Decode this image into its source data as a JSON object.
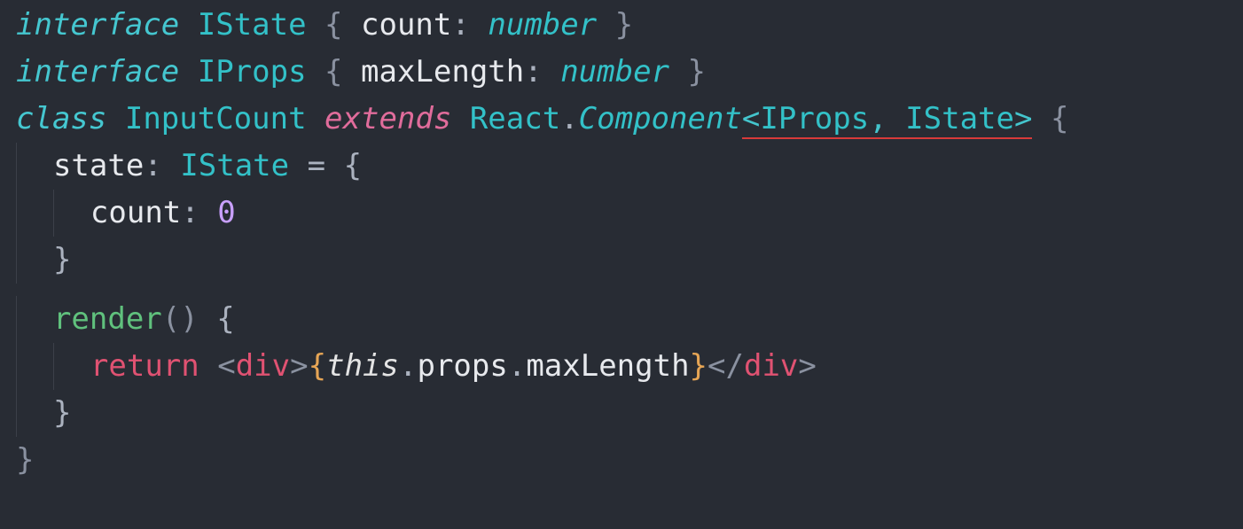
{
  "code": {
    "lines": [
      {
        "tokens": [
          {
            "cls": "kw",
            "t": "interface"
          },
          {
            "cls": "",
            "t": " "
          },
          {
            "cls": "type",
            "t": "IState"
          },
          {
            "cls": "",
            "t": " "
          },
          {
            "cls": "pale",
            "t": "{"
          },
          {
            "cls": "",
            "t": " "
          },
          {
            "cls": "ident",
            "t": "count"
          },
          {
            "cls": "punc",
            "t": ":"
          },
          {
            "cls": "",
            "t": " "
          },
          {
            "cls": "typei",
            "t": "number"
          },
          {
            "cls": "",
            "t": " "
          },
          {
            "cls": "pale",
            "t": "}"
          }
        ]
      },
      {
        "tokens": [
          {
            "cls": "kw",
            "t": "interface"
          },
          {
            "cls": "",
            "t": " "
          },
          {
            "cls": "type",
            "t": "IProps"
          },
          {
            "cls": "",
            "t": " "
          },
          {
            "cls": "pale",
            "t": "{"
          },
          {
            "cls": "",
            "t": " "
          },
          {
            "cls": "ident",
            "t": "maxLength"
          },
          {
            "cls": "punc",
            "t": ":"
          },
          {
            "cls": "",
            "t": " "
          },
          {
            "cls": "typei",
            "t": "number"
          },
          {
            "cls": "",
            "t": " "
          },
          {
            "cls": "pale",
            "t": "}"
          }
        ]
      },
      {
        "tokens": [
          {
            "cls": "kw",
            "t": "class"
          },
          {
            "cls": "",
            "t": " "
          },
          {
            "cls": "type",
            "t": "InputCount"
          },
          {
            "cls": "",
            "t": " "
          },
          {
            "cls": "kw2",
            "t": "extends"
          },
          {
            "cls": "",
            "t": " "
          },
          {
            "cls": "type",
            "t": "React"
          },
          {
            "cls": "punc",
            "t": "."
          },
          {
            "cls": "typei",
            "t": "Component"
          },
          {
            "cls": "genang uline",
            "t": "<"
          },
          {
            "cls": "type uline",
            "t": "IProps"
          },
          {
            "cls": "genang uline",
            "t": ","
          },
          {
            "cls": "uline",
            "t": " "
          },
          {
            "cls": "type uline",
            "t": "IState"
          },
          {
            "cls": "genang uline",
            "t": ">"
          },
          {
            "cls": "",
            "t": " "
          },
          {
            "cls": "pale",
            "t": "{"
          }
        ]
      },
      {
        "indent": 1,
        "tokens": [
          {
            "cls": "ident",
            "t": "state"
          },
          {
            "cls": "punc",
            "t": ":"
          },
          {
            "cls": "",
            "t": " "
          },
          {
            "cls": "type",
            "t": "IState"
          },
          {
            "cls": "",
            "t": " "
          },
          {
            "cls": "punc",
            "t": "="
          },
          {
            "cls": "",
            "t": " "
          },
          {
            "cls": "punc",
            "t": "{"
          }
        ]
      },
      {
        "indent": 2,
        "tokens": [
          {
            "cls": "ident",
            "t": "count"
          },
          {
            "cls": "punc",
            "t": ":"
          },
          {
            "cls": "",
            "t": " "
          },
          {
            "cls": "num",
            "t": "0"
          }
        ]
      },
      {
        "indent": 1,
        "tokens": [
          {
            "cls": "punc",
            "t": "}"
          }
        ]
      },
      {
        "indent": 1,
        "tokens": [
          {
            "cls": "fn",
            "t": "render"
          },
          {
            "cls": "pale",
            "t": "()"
          },
          {
            "cls": "",
            "t": " "
          },
          {
            "cls": "punc",
            "t": "{"
          }
        ]
      },
      {
        "indent": 2,
        "tokens": [
          {
            "cls": "ret",
            "t": "return"
          },
          {
            "cls": "",
            "t": " "
          },
          {
            "cls": "tagang",
            "t": "<"
          },
          {
            "cls": "tagname",
            "t": "div"
          },
          {
            "cls": "tagang",
            "t": ">"
          },
          {
            "cls": "jsxcurl",
            "t": "{"
          },
          {
            "cls": "this",
            "t": "this"
          },
          {
            "cls": "punc",
            "t": "."
          },
          {
            "cls": "ident",
            "t": "props"
          },
          {
            "cls": "punc",
            "t": "."
          },
          {
            "cls": "ident",
            "t": "maxLength"
          },
          {
            "cls": "jsxcurl",
            "t": "}"
          },
          {
            "cls": "tagang",
            "t": "</"
          },
          {
            "cls": "tagname",
            "t": "div"
          },
          {
            "cls": "tagang",
            "t": ">"
          }
        ]
      },
      {
        "indent": 1,
        "tokens": [
          {
            "cls": "punc",
            "t": "}"
          }
        ]
      },
      {
        "tokens": [
          {
            "cls": "pale",
            "t": "}"
          }
        ]
      }
    ]
  },
  "spacer_after": [
    5
  ]
}
